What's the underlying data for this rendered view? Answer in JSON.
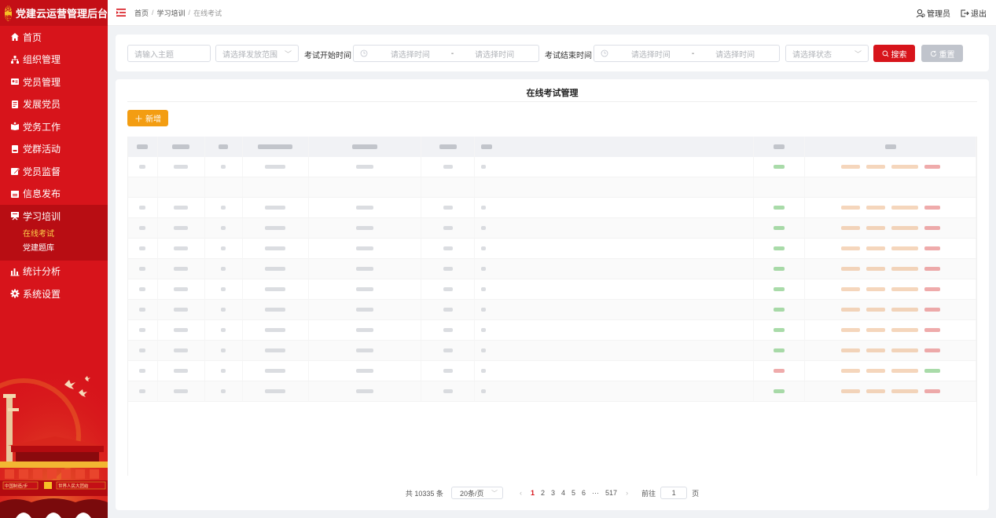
{
  "app": {
    "title": "党建云运营管理后台",
    "logo_text": "党建"
  },
  "sidebar": {
    "items": [
      {
        "label": "首页",
        "icon": "home-icon"
      },
      {
        "label": "组织管理",
        "icon": "org-icon"
      },
      {
        "label": "党员管理",
        "icon": "member-card-icon"
      },
      {
        "label": "发展党员",
        "icon": "document-icon"
      },
      {
        "label": "党务工作",
        "icon": "book-icon"
      },
      {
        "label": "党群活动",
        "icon": "activity-icon"
      },
      {
        "label": "党员监督",
        "icon": "edit-icon"
      },
      {
        "label": "信息发布",
        "icon": "calendar-icon"
      },
      {
        "label": "学习培训",
        "icon": "study-icon",
        "open": true
      },
      {
        "label": "统计分析",
        "icon": "bar-chart-icon"
      },
      {
        "label": "系统设置",
        "icon": "gear-icon"
      }
    ],
    "submenu": [
      {
        "label": "在线考试",
        "active": true
      },
      {
        "label": "党建题库",
        "active": false
      }
    ],
    "banner_text_left": "中国制造/步",
    "banner_text_right": "世界人民大团结"
  },
  "header": {
    "breadcrumb": [
      "首页",
      "学习培训",
      "在线考试"
    ],
    "user_label": "管理员",
    "logout_label": "退出"
  },
  "filters": {
    "topic_placeholder": "请输入主题",
    "scope_placeholder": "请选择发放范围",
    "start_label": "考试开始时间",
    "end_label": "考试结束时间",
    "time_placeholder": "请选择时间",
    "range_sep": "-",
    "status_placeholder": "请选择状态",
    "search_label": "搜索",
    "reset_label": "重置"
  },
  "main": {
    "title": "在线考试管理",
    "add_label": "新增"
  },
  "colors": {
    "primary": "#d7141b",
    "accent": "#f39d12",
    "active_sub": "#ffd34a"
  },
  "pagination": {
    "total_text": "共 10335 条",
    "page_size": "20条/页",
    "pages": [
      "1",
      "2",
      "3",
      "4",
      "5",
      "6",
      "···",
      "517"
    ],
    "current": "1",
    "goto_label": "前往",
    "goto_value": "1",
    "page_unit": "页"
  }
}
